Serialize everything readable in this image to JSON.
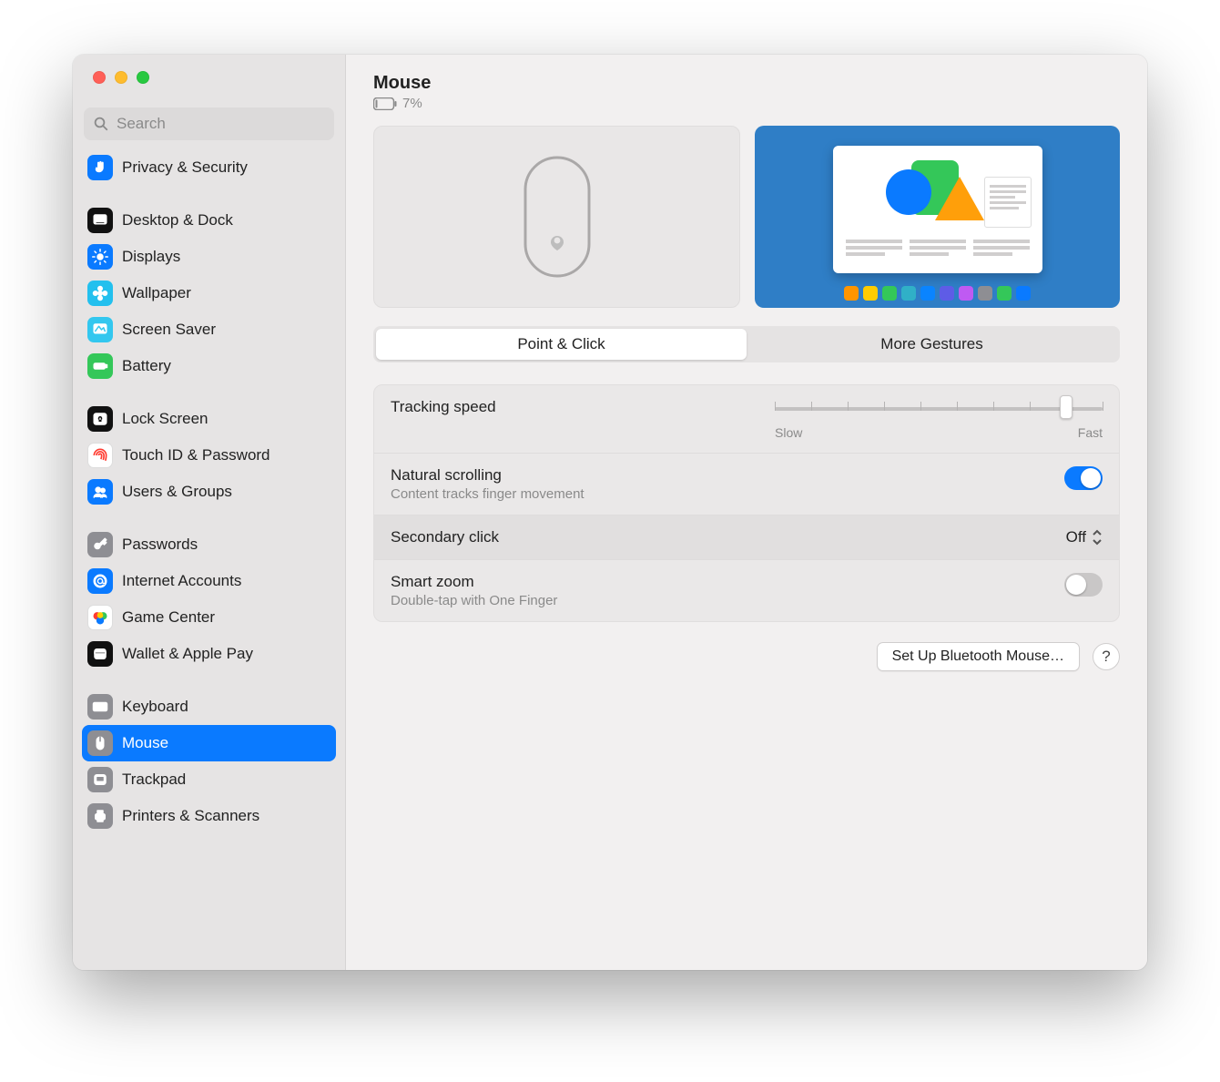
{
  "header": {
    "title": "Mouse",
    "battery_percent": "7%"
  },
  "search": {
    "placeholder": "Search"
  },
  "sidebar": {
    "groups": [
      [
        {
          "key": "privacy-security",
          "label": "Privacy & Security",
          "icon": "hand-icon",
          "bg": "#0a7aff"
        }
      ],
      [
        {
          "key": "desktop-dock",
          "label": "Desktop & Dock",
          "icon": "dock-icon",
          "bg": "#111"
        },
        {
          "key": "displays",
          "label": "Displays",
          "icon": "brightness-icon",
          "bg": "#0a7aff"
        },
        {
          "key": "wallpaper",
          "label": "Wallpaper",
          "icon": "flower-icon",
          "bg": "#23c0ee"
        },
        {
          "key": "screen-saver",
          "label": "Screen Saver",
          "icon": "screensaver-icon",
          "bg": "#33c7ef"
        },
        {
          "key": "battery",
          "label": "Battery",
          "icon": "battery-icon",
          "bg": "#34c759"
        }
      ],
      [
        {
          "key": "lock-screen",
          "label": "Lock Screen",
          "icon": "lock-icon",
          "bg": "#111"
        },
        {
          "key": "touch-id",
          "label": "Touch ID & Password",
          "icon": "fingerprint-icon",
          "bg": "#fff",
          "fg": "#ff3b30",
          "border": true
        },
        {
          "key": "users-groups",
          "label": "Users & Groups",
          "icon": "users-icon",
          "bg": "#0a7aff"
        }
      ],
      [
        {
          "key": "passwords",
          "label": "Passwords",
          "icon": "key-icon",
          "bg": "#8e8e93"
        },
        {
          "key": "internet-accounts",
          "label": "Internet Accounts",
          "icon": "at-icon",
          "bg": "#0a7aff"
        },
        {
          "key": "game-center",
          "label": "Game Center",
          "icon": "gamecenter-icon",
          "bg": "#fff",
          "border": true
        },
        {
          "key": "wallet-apple-pay",
          "label": "Wallet & Apple Pay",
          "icon": "wallet-icon",
          "bg": "#111"
        }
      ],
      [
        {
          "key": "keyboard",
          "label": "Keyboard",
          "icon": "keyboard-icon",
          "bg": "#8e8e93"
        },
        {
          "key": "mouse",
          "label": "Mouse",
          "icon": "mouse-icon",
          "bg": "#8e8e93",
          "selected": true
        },
        {
          "key": "trackpad",
          "label": "Trackpad",
          "icon": "trackpad-icon",
          "bg": "#8e8e93"
        },
        {
          "key": "printers-scanners",
          "label": "Printers & Scanners",
          "icon": "printer-icon",
          "bg": "#8e8e93"
        }
      ]
    ]
  },
  "tabs": {
    "items": [
      "Point & Click",
      "More Gestures"
    ],
    "active_index": 0
  },
  "settings": {
    "tracking": {
      "title": "Tracking speed",
      "min_label": "Slow",
      "max_label": "Fast",
      "value_index": 8,
      "ticks": 10
    },
    "natural_scrolling": {
      "title": "Natural scrolling",
      "sub": "Content tracks finger movement",
      "on": true
    },
    "secondary_click": {
      "title": "Secondary click",
      "value": "Off"
    },
    "smart_zoom": {
      "title": "Smart zoom",
      "sub": "Double-tap with One Finger",
      "on": false
    }
  },
  "footer": {
    "setup_button": "Set Up Bluetooth Mouse…",
    "help_label": "?"
  },
  "colors": {
    "accent": "#0a7aff"
  },
  "dock_colors": [
    "#ff9500",
    "#ffcc00",
    "#34c759",
    "#30b0c7",
    "#0a84ff",
    "#5e5ce6",
    "#bf5af2",
    "#8e8e93",
    "#34c759",
    "#0a7aff"
  ]
}
